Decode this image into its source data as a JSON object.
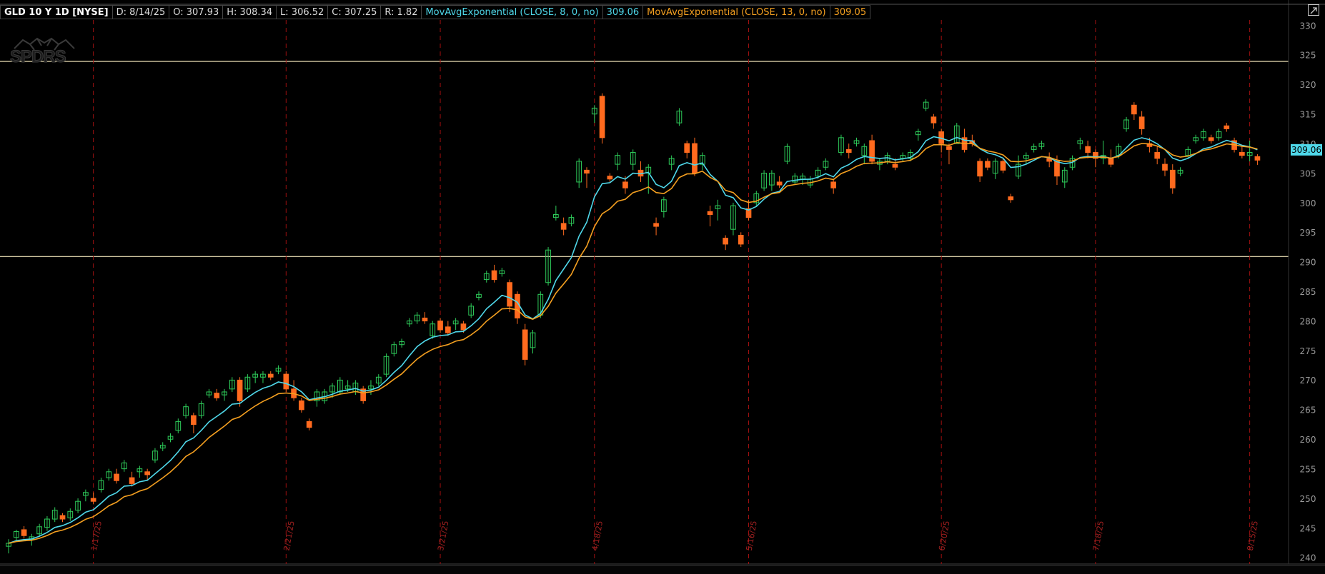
{
  "header": {
    "symbol": "GLD 10 Y 1D [NYSE]",
    "date": "D: 8/14/25",
    "open": "O: 307.93",
    "high": "H: 308.34",
    "low": "L: 306.52",
    "close": "C: 307.25",
    "range": "R: 1.82",
    "ema8_label": "MovAvgExponential (CLOSE, 8, 0, no)",
    "ema8_value": "309.06",
    "ema13_label": "MovAvgExponential (CLOSE, 13, 0, no)",
    "ema13_value": "309.05"
  },
  "watermark": "SPDRS",
  "colors": {
    "background": "#000000",
    "up": "#2ecc5a",
    "down": "#ff6a1e",
    "ema8": "#4fd8ea",
    "ema13": "#f5a020",
    "hline": "#efe3b8",
    "vline": "#a01010",
    "axis_text": "#999999"
  },
  "chart_data": {
    "type": "candlestick",
    "symbol": "GLD",
    "ylim": [
      239,
      331
    ],
    "y_ticks": [
      240,
      245,
      250,
      255,
      260,
      265,
      270,
      275,
      280,
      285,
      290,
      295,
      300,
      305,
      310,
      315,
      320,
      325,
      330
    ],
    "price_label": "309.06",
    "horizontal_lines": [
      324,
      291
    ],
    "date_markers": [
      {
        "label": "1/17/25",
        "index": 11
      },
      {
        "label": "2/21/25",
        "index": 36
      },
      {
        "label": "3/21/25",
        "index": 56
      },
      {
        "label": "4/18/25",
        "index": 76
      },
      {
        "label": "5/16/25",
        "index": 96
      },
      {
        "label": "6/20/25",
        "index": 121
      },
      {
        "label": "7/18/25",
        "index": 141
      },
      {
        "label": "8/15/25",
        "index": 161
      }
    ],
    "candles": [
      {
        "o": 242.0,
        "h": 243.2,
        "l": 240.8,
        "c": 242.5
      },
      {
        "o": 243.5,
        "h": 244.8,
        "l": 242.8,
        "c": 244.5
      },
      {
        "o": 244.8,
        "h": 245.4,
        "l": 243.3,
        "c": 243.8
      },
      {
        "o": 243.2,
        "h": 244.1,
        "l": 242.1,
        "c": 243.6
      },
      {
        "o": 244.1,
        "h": 245.8,
        "l": 243.6,
        "c": 245.3
      },
      {
        "o": 245.2,
        "h": 247.1,
        "l": 244.6,
        "c": 246.6
      },
      {
        "o": 246.6,
        "h": 248.6,
        "l": 246.1,
        "c": 248.1
      },
      {
        "o": 247.2,
        "h": 247.6,
        "l": 246.1,
        "c": 246.6
      },
      {
        "o": 246.8,
        "h": 248.4,
        "l": 246.3,
        "c": 247.9
      },
      {
        "o": 248.1,
        "h": 250.1,
        "l": 247.6,
        "c": 249.6
      },
      {
        "o": 250.6,
        "h": 251.6,
        "l": 249.6,
        "c": 251.1
      },
      {
        "o": 250.1,
        "h": 251.1,
        "l": 249.1,
        "c": 249.6
      },
      {
        "o": 251.6,
        "h": 253.6,
        "l": 251.1,
        "c": 253.1
      },
      {
        "o": 253.6,
        "h": 255.1,
        "l": 253.1,
        "c": 254.6
      },
      {
        "o": 254.2,
        "h": 255.1,
        "l": 252.6,
        "c": 253.1
      },
      {
        "o": 255.1,
        "h": 256.6,
        "l": 254.6,
        "c": 256.1
      },
      {
        "o": 253.6,
        "h": 254.6,
        "l": 252.1,
        "c": 252.6
      },
      {
        "o": 254.6,
        "h": 255.6,
        "l": 253.6,
        "c": 255.1
      },
      {
        "o": 254.6,
        "h": 255.1,
        "l": 253.1,
        "c": 254.1
      },
      {
        "o": 256.6,
        "h": 258.6,
        "l": 256.1,
        "c": 258.1
      },
      {
        "o": 258.6,
        "h": 259.6,
        "l": 258.1,
        "c": 259.1
      },
      {
        "o": 260.1,
        "h": 261.1,
        "l": 259.6,
        "c": 260.6
      },
      {
        "o": 261.6,
        "h": 263.6,
        "l": 261.1,
        "c": 263.1
      },
      {
        "o": 264.1,
        "h": 266.1,
        "l": 263.6,
        "c": 265.6
      },
      {
        "o": 264.1,
        "h": 264.6,
        "l": 261.1,
        "c": 262.6
      },
      {
        "o": 264.1,
        "h": 266.6,
        "l": 263.6,
        "c": 266.1
      },
      {
        "o": 267.6,
        "h": 268.6,
        "l": 267.1,
        "c": 268.1
      },
      {
        "o": 267.9,
        "h": 268.6,
        "l": 266.6,
        "c": 267.1
      },
      {
        "o": 267.6,
        "h": 268.6,
        "l": 266.6,
        "c": 268.1
      },
      {
        "o": 268.6,
        "h": 270.6,
        "l": 268.1,
        "c": 270.1
      },
      {
        "o": 270.1,
        "h": 270.6,
        "l": 265.6,
        "c": 266.6
      },
      {
        "o": 268.6,
        "h": 271.1,
        "l": 268.1,
        "c": 270.6
      },
      {
        "o": 270.6,
        "h": 271.6,
        "l": 269.6,
        "c": 271.1
      },
      {
        "o": 270.6,
        "h": 271.6,
        "l": 269.6,
        "c": 271.1
      },
      {
        "o": 271.1,
        "h": 271.6,
        "l": 270.1,
        "c": 270.6
      },
      {
        "o": 271.6,
        "h": 272.6,
        "l": 271.1,
        "c": 272.1
      },
      {
        "o": 271.1,
        "h": 271.6,
        "l": 268.1,
        "c": 268.6
      },
      {
        "o": 268.6,
        "h": 270.1,
        "l": 266.6,
        "c": 267.1
      },
      {
        "o": 266.6,
        "h": 267.1,
        "l": 264.6,
        "c": 265.1
      },
      {
        "o": 263.1,
        "h": 263.6,
        "l": 261.6,
        "c": 262.1
      },
      {
        "o": 266.6,
        "h": 268.6,
        "l": 265.6,
        "c": 268.1
      },
      {
        "o": 266.6,
        "h": 268.6,
        "l": 266.1,
        "c": 268.1
      },
      {
        "o": 268.1,
        "h": 269.6,
        "l": 267.1,
        "c": 269.1
      },
      {
        "o": 268.1,
        "h": 270.6,
        "l": 267.6,
        "c": 270.1
      },
      {
        "o": 268.6,
        "h": 270.1,
        "l": 268.1,
        "c": 269.1
      },
      {
        "o": 268.1,
        "h": 270.1,
        "l": 267.6,
        "c": 269.6
      },
      {
        "o": 268.6,
        "h": 269.1,
        "l": 266.1,
        "c": 266.6
      },
      {
        "o": 268.6,
        "h": 270.1,
        "l": 267.6,
        "c": 269.1
      },
      {
        "o": 269.6,
        "h": 271.1,
        "l": 269.1,
        "c": 270.6
      },
      {
        "o": 271.1,
        "h": 274.6,
        "l": 270.6,
        "c": 274.1
      },
      {
        "o": 274.6,
        "h": 276.6,
        "l": 274.1,
        "c": 276.1
      },
      {
        "o": 276.1,
        "h": 277.1,
        "l": 275.6,
        "c": 276.6
      },
      {
        "o": 279.6,
        "h": 280.6,
        "l": 279.1,
        "c": 280.1
      },
      {
        "o": 280.1,
        "h": 281.6,
        "l": 279.6,
        "c": 281.1
      },
      {
        "o": 280.6,
        "h": 281.6,
        "l": 279.6,
        "c": 280.1
      },
      {
        "o": 277.6,
        "h": 280.1,
        "l": 277.1,
        "c": 279.6
      },
      {
        "o": 280.1,
        "h": 280.6,
        "l": 278.1,
        "c": 278.6
      },
      {
        "o": 279.1,
        "h": 280.1,
        "l": 277.6,
        "c": 278.1
      },
      {
        "o": 279.6,
        "h": 280.6,
        "l": 278.6,
        "c": 280.1
      },
      {
        "o": 279.6,
        "h": 280.1,
        "l": 278.1,
        "c": 278.6
      },
      {
        "o": 281.1,
        "h": 283.1,
        "l": 280.6,
        "c": 282.6
      },
      {
        "o": 284.1,
        "h": 285.1,
        "l": 283.6,
        "c": 284.6
      },
      {
        "o": 287.1,
        "h": 288.6,
        "l": 286.6,
        "c": 288.1
      },
      {
        "o": 288.6,
        "h": 289.6,
        "l": 286.6,
        "c": 287.1
      },
      {
        "o": 288.1,
        "h": 289.1,
        "l": 287.6,
        "c": 288.6
      },
      {
        "o": 286.6,
        "h": 287.1,
        "l": 281.6,
        "c": 282.6
      },
      {
        "o": 284.6,
        "h": 285.1,
        "l": 279.6,
        "c": 280.6
      },
      {
        "o": 278.6,
        "h": 279.6,
        "l": 272.6,
        "c": 273.6
      },
      {
        "o": 275.6,
        "h": 278.6,
        "l": 274.6,
        "c": 278.1
      },
      {
        "o": 281.1,
        "h": 285.1,
        "l": 280.6,
        "c": 284.6
      },
      {
        "o": 286.6,
        "h": 292.6,
        "l": 286.1,
        "c": 292.1
      },
      {
        "o": 297.6,
        "h": 299.6,
        "l": 297.1,
        "c": 298.1
      },
      {
        "o": 296.6,
        "h": 297.6,
        "l": 294.6,
        "c": 295.6
      },
      {
        "o": 296.6,
        "h": 298.1,
        "l": 296.1,
        "c": 297.6
      },
      {
        "o": 303.6,
        "h": 307.6,
        "l": 302.6,
        "c": 307.1
      },
      {
        "o": 305.6,
        "h": 306.1,
        "l": 302.6,
        "c": 305.1
      },
      {
        "o": 315.1,
        "h": 316.6,
        "l": 313.6,
        "c": 316.1
      },
      {
        "o": 318.1,
        "h": 318.6,
        "l": 310.1,
        "c": 311.1
      },
      {
        "o": 304.6,
        "h": 305.1,
        "l": 303.6,
        "c": 304.1
      },
      {
        "o": 306.6,
        "h": 308.6,
        "l": 305.6,
        "c": 308.1
      },
      {
        "o": 303.6,
        "h": 304.6,
        "l": 301.6,
        "c": 302.6
      },
      {
        "o": 306.6,
        "h": 309.1,
        "l": 305.6,
        "c": 308.6
      },
      {
        "o": 305.6,
        "h": 307.1,
        "l": 303.6,
        "c": 304.6
      },
      {
        "o": 305.1,
        "h": 306.6,
        "l": 301.6,
        "c": 306.1
      },
      {
        "o": 296.6,
        "h": 297.6,
        "l": 294.6,
        "c": 296.1
      },
      {
        "o": 298.6,
        "h": 301.1,
        "l": 297.6,
        "c": 300.6
      },
      {
        "o": 306.6,
        "h": 308.1,
        "l": 305.6,
        "c": 307.6
      },
      {
        "o": 313.6,
        "h": 316.1,
        "l": 313.1,
        "c": 315.6
      },
      {
        "o": 310.1,
        "h": 310.6,
        "l": 307.6,
        "c": 308.6
      },
      {
        "o": 310.1,
        "h": 311.1,
        "l": 304.6,
        "c": 305.1
      },
      {
        "o": 306.6,
        "h": 308.6,
        "l": 305.6,
        "c": 308.1
      },
      {
        "o": 298.6,
        "h": 299.6,
        "l": 296.1,
        "c": 298.1
      },
      {
        "o": 299.1,
        "h": 300.6,
        "l": 297.1,
        "c": 299.6
      },
      {
        "o": 294.1,
        "h": 294.6,
        "l": 292.1,
        "c": 293.1
      },
      {
        "o": 295.6,
        "h": 300.1,
        "l": 294.6,
        "c": 299.6
      },
      {
        "o": 294.6,
        "h": 295.1,
        "l": 292.6,
        "c": 293.1
      },
      {
        "o": 299.1,
        "h": 300.6,
        "l": 297.1,
        "c": 297.6
      },
      {
        "o": 300.1,
        "h": 302.1,
        "l": 299.6,
        "c": 301.6
      },
      {
        "o": 302.6,
        "h": 305.6,
        "l": 302.1,
        "c": 305.1
      },
      {
        "o": 303.1,
        "h": 305.6,
        "l": 302.1,
        "c": 305.1
      },
      {
        "o": 303.6,
        "h": 304.6,
        "l": 302.6,
        "c": 303.1
      },
      {
        "o": 307.1,
        "h": 310.1,
        "l": 306.6,
        "c": 309.6
      },
      {
        "o": 303.6,
        "h": 305.1,
        "l": 303.1,
        "c": 304.6
      },
      {
        "o": 304.1,
        "h": 305.1,
        "l": 303.1,
        "c": 304.6
      },
      {
        "o": 303.1,
        "h": 304.6,
        "l": 302.6,
        "c": 304.1
      },
      {
        "o": 304.6,
        "h": 306.1,
        "l": 304.1,
        "c": 305.6
      },
      {
        "o": 306.1,
        "h": 307.6,
        "l": 305.6,
        "c": 307.1
      },
      {
        "o": 303.6,
        "h": 304.1,
        "l": 301.6,
        "c": 302.6
      },
      {
        "o": 308.6,
        "h": 311.6,
        "l": 308.1,
        "c": 311.1
      },
      {
        "o": 309.1,
        "h": 310.1,
        "l": 307.6,
        "c": 308.6
      },
      {
        "o": 310.1,
        "h": 311.1,
        "l": 309.6,
        "c": 310.6
      },
      {
        "o": 308.1,
        "h": 310.1,
        "l": 306.6,
        "c": 309.6
      },
      {
        "o": 310.6,
        "h": 311.6,
        "l": 306.6,
        "c": 307.1
      },
      {
        "o": 306.6,
        "h": 307.6,
        "l": 305.6,
        "c": 307.1
      },
      {
        "o": 307.1,
        "h": 308.6,
        "l": 306.6,
        "c": 308.1
      },
      {
        "o": 306.6,
        "h": 307.6,
        "l": 305.6,
        "c": 306.1
      },
      {
        "o": 307.6,
        "h": 308.6,
        "l": 307.1,
        "c": 308.1
      },
      {
        "o": 307.6,
        "h": 309.1,
        "l": 307.1,
        "c": 308.6
      },
      {
        "o": 311.6,
        "h": 312.6,
        "l": 310.6,
        "c": 312.1
      },
      {
        "o": 316.1,
        "h": 317.6,
        "l": 315.6,
        "c": 317.1
      },
      {
        "o": 314.6,
        "h": 315.1,
        "l": 312.6,
        "c": 313.6
      },
      {
        "o": 312.1,
        "h": 312.6,
        "l": 308.6,
        "c": 310.1
      },
      {
        "o": 309.6,
        "h": 310.1,
        "l": 306.6,
        "c": 309.1
      },
      {
        "o": 310.1,
        "h": 313.6,
        "l": 310.1,
        "c": 313.1
      },
      {
        "o": 311.1,
        "h": 312.6,
        "l": 308.6,
        "c": 309.1
      },
      {
        "o": 310.6,
        "h": 311.6,
        "l": 309.6,
        "c": 310.1
      },
      {
        "o": 307.1,
        "h": 307.6,
        "l": 303.6,
        "c": 304.6
      },
      {
        "o": 307.1,
        "h": 307.6,
        "l": 305.6,
        "c": 306.1
      },
      {
        "o": 305.1,
        "h": 307.6,
        "l": 304.1,
        "c": 307.1
      },
      {
        "o": 307.1,
        "h": 307.6,
        "l": 305.1,
        "c": 305.6
      },
      {
        "o": 301.1,
        "h": 301.6,
        "l": 300.1,
        "c": 300.6
      },
      {
        "o": 304.6,
        "h": 308.1,
        "l": 304.1,
        "c": 306.6
      },
      {
        "o": 307.6,
        "h": 308.6,
        "l": 306.6,
        "c": 308.1
      },
      {
        "o": 309.1,
        "h": 310.1,
        "l": 308.6,
        "c": 309.6
      },
      {
        "o": 309.6,
        "h": 310.6,
        "l": 309.1,
        "c": 310.1
      },
      {
        "o": 307.6,
        "h": 308.6,
        "l": 306.1,
        "c": 307.1
      },
      {
        "o": 307.1,
        "h": 308.1,
        "l": 303.1,
        "c": 304.6
      },
      {
        "o": 303.6,
        "h": 306.1,
        "l": 302.6,
        "c": 305.6
      },
      {
        "o": 306.1,
        "h": 308.1,
        "l": 305.6,
        "c": 307.6
      },
      {
        "o": 310.1,
        "h": 311.1,
        "l": 309.1,
        "c": 310.6
      },
      {
        "o": 309.6,
        "h": 310.6,
        "l": 307.6,
        "c": 308.6
      },
      {
        "o": 308.6,
        "h": 309.1,
        "l": 306.1,
        "c": 307.6
      },
      {
        "o": 307.6,
        "h": 310.6,
        "l": 306.6,
        "c": 308.1
      },
      {
        "o": 307.6,
        "h": 309.1,
        "l": 306.1,
        "c": 306.6
      },
      {
        "o": 308.1,
        "h": 310.1,
        "l": 307.6,
        "c": 309.6
      },
      {
        "o": 312.6,
        "h": 314.6,
        "l": 312.1,
        "c": 314.1
      },
      {
        "o": 316.6,
        "h": 317.1,
        "l": 314.1,
        "c": 315.1
      },
      {
        "o": 314.6,
        "h": 315.6,
        "l": 311.6,
        "c": 312.6
      },
      {
        "o": 310.1,
        "h": 311.1,
        "l": 308.6,
        "c": 309.6
      },
      {
        "o": 308.6,
        "h": 309.6,
        "l": 306.6,
        "c": 307.6
      },
      {
        "o": 306.6,
        "h": 307.6,
        "l": 304.6,
        "c": 305.6
      },
      {
        "o": 305.6,
        "h": 306.6,
        "l": 301.6,
        "c": 302.6
      },
      {
        "o": 305.1,
        "h": 306.1,
        "l": 304.6,
        "c": 305.6
      },
      {
        "o": 308.1,
        "h": 309.6,
        "l": 307.6,
        "c": 309.1
      },
      {
        "o": 310.6,
        "h": 311.6,
        "l": 310.1,
        "c": 311.1
      },
      {
        "o": 311.1,
        "h": 312.6,
        "l": 310.6,
        "c": 312.1
      },
      {
        "o": 311.1,
        "h": 311.6,
        "l": 310.1,
        "c": 310.6
      },
      {
        "o": 311.1,
        "h": 312.6,
        "l": 310.6,
        "c": 312.1
      },
      {
        "o": 313.1,
        "h": 313.6,
        "l": 312.1,
        "c": 312.6
      },
      {
        "o": 310.6,
        "h": 311.1,
        "l": 308.6,
        "c": 309.1
      },
      {
        "o": 308.6,
        "h": 309.6,
        "l": 307.6,
        "c": 308.1
      },
      {
        "o": 308.1,
        "h": 310.6,
        "l": 307.1,
        "c": 308.6
      },
      {
        "o": 307.9,
        "h": 308.3,
        "l": 306.5,
        "c": 307.3
      }
    ]
  }
}
